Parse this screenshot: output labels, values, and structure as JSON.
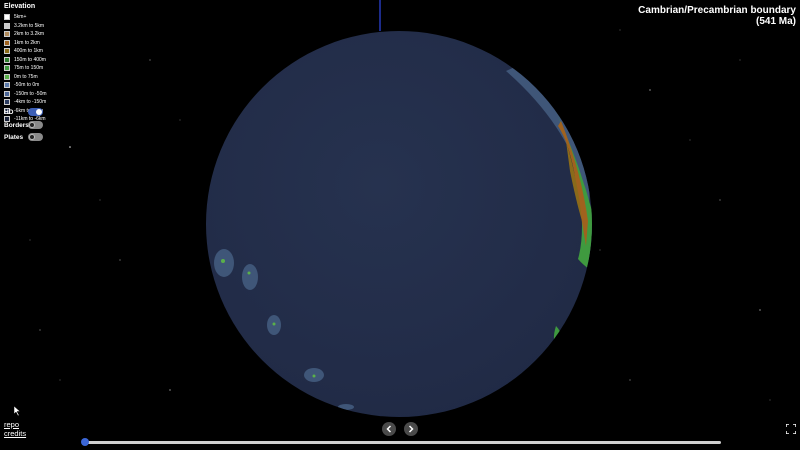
{
  "legend": {
    "title": "Elevation",
    "items": [
      {
        "label": "5km+",
        "color": "#ffffff"
      },
      {
        "label": "3.2km to 5km",
        "color": "#c8c8c8"
      },
      {
        "label": "2km to 3.2km",
        "color": "#b08a5a"
      },
      {
        "label": "1km to 2km",
        "color": "#a0621e"
      },
      {
        "label": "400m to 1km",
        "color": "#8a6a1a"
      },
      {
        "label": "150m to 400m",
        "color": "#2e7d2e"
      },
      {
        "label": "75m to 150m",
        "color": "#3f9a3f"
      },
      {
        "label": "0m to 75m",
        "color": "#5ab04a"
      },
      {
        "label": "-50m to 0m",
        "color": "#5a78a8"
      },
      {
        "label": "-150m to -50m",
        "color": "#4a6494"
      },
      {
        "label": "-4km to -150m",
        "color": "#2a3a5e"
      },
      {
        "label": "-6km to -4km",
        "color": "#222c48"
      },
      {
        "label": "-11km to -6km",
        "color": "#1a2238"
      }
    ]
  },
  "toggles": [
    {
      "label": "HD",
      "on": true
    },
    {
      "label": "Borders",
      "on": false
    },
    {
      "label": "Plates",
      "on": false
    }
  ],
  "header": {
    "title_line1": "Cambrian/Precambrian boundary",
    "title_line2": "(541 Ma)"
  },
  "links": {
    "repo": "repo",
    "credits": "credits"
  },
  "timeline": {
    "position": 0.0
  },
  "colors": {
    "ocean_deep": "#222c48",
    "shelf": "#3f5678",
    "slider_thumb": "#3b66d6"
  }
}
